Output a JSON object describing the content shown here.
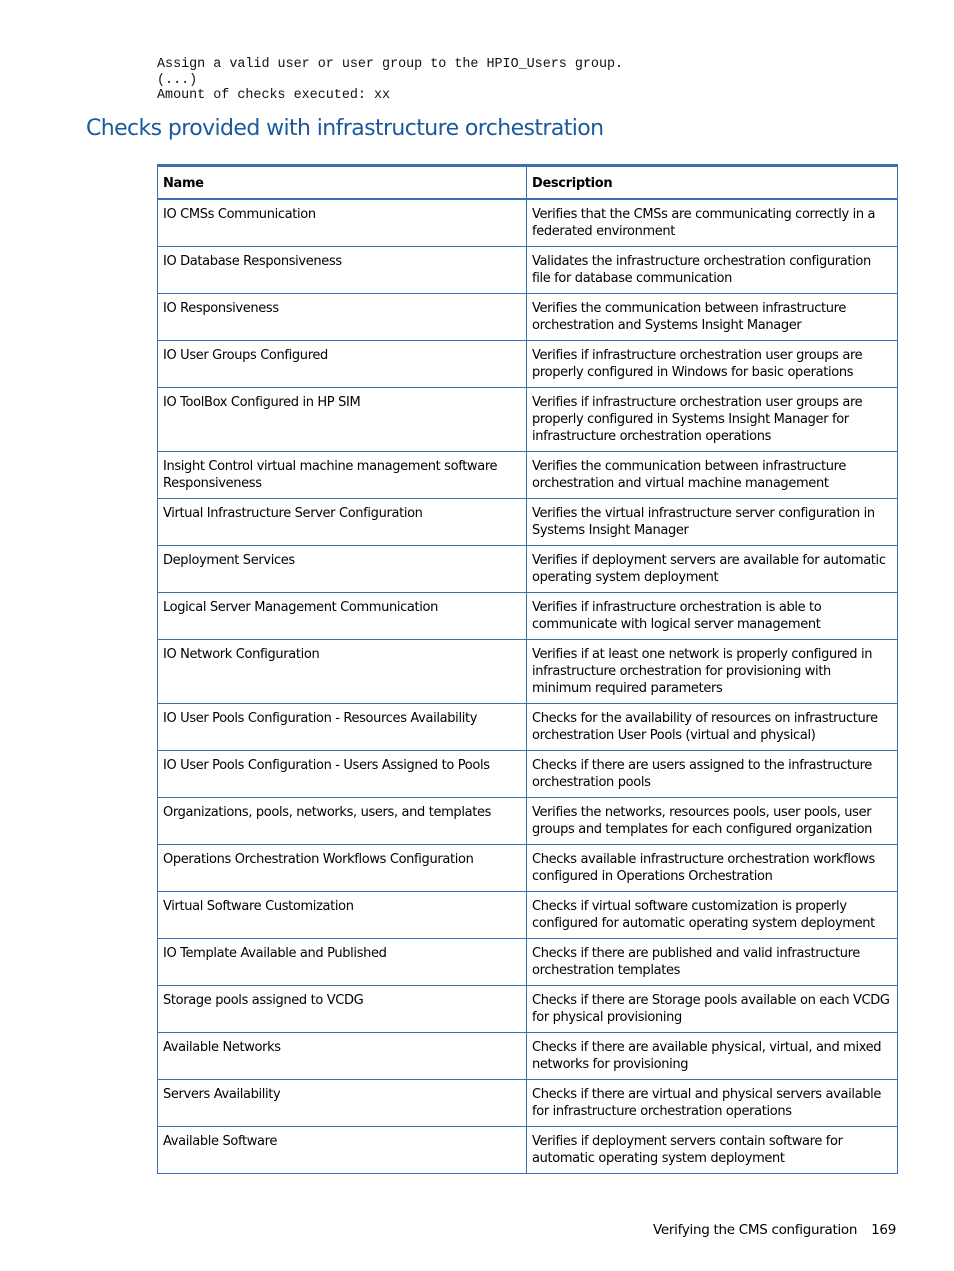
{
  "code_block": {
    "lines": [
      "Assign a valid user or user group to the HPIO_Users group.",
      "(...)",
      "Amount of checks executed: xx"
    ]
  },
  "section_title": "Checks provided with infrastructure orchestration",
  "table": {
    "headers": [
      "Name",
      "Description"
    ],
    "rows": [
      {
        "name": "IO CMSs Communication",
        "description": "Verifies that the CMSs are communicating correctly in a federated environment"
      },
      {
        "name": "IO Database Responsiveness",
        "description": "Validates the infrastructure orchestration configuration file for database communication"
      },
      {
        "name": "IO Responsiveness",
        "description": "Verifies the communication between infrastructure orchestration and Systems Insight Manager"
      },
      {
        "name": "IO User Groups Configured",
        "description": "Verifies if infrastructure orchestration user groups are properly configured in Windows for basic operations"
      },
      {
        "name": "IO ToolBox Configured in HP SIM",
        "description": "Verifies if infrastructure orchestration user groups are properly configured in Systems Insight Manager for infrastructure orchestration operations"
      },
      {
        "name": "Insight Control virtual machine management software Responsiveness",
        "description": "Verifies the communication between infrastructure orchestration and virtual machine management"
      },
      {
        "name": "Virtual Infrastructure Server Configuration",
        "description": "Verifies the virtual infrastructure server configuration in Systems Insight Manager"
      },
      {
        "name": "Deployment Services",
        "description": "Verifies if deployment servers are available for automatic operating system deployment"
      },
      {
        "name": "Logical Server Management Communication",
        "description": "Verifies if infrastructure orchestration is able to communicate with logical server management"
      },
      {
        "name": "IO Network Configuration",
        "description": "Verifies if at least one network is properly configured in infrastructure orchestration for provisioning with minimum required parameters"
      },
      {
        "name": "IO User Pools Configuration - Resources Availability",
        "description": "Checks for the availability of resources on infrastructure orchestration User Pools (virtual and physical)"
      },
      {
        "name": "IO User Pools Configuration - Users Assigned to Pools",
        "description": "Checks if there are users assigned to the infrastructure orchestration pools"
      },
      {
        "name": "Organizations, pools, networks, users, and templates",
        "description": "Verifies the networks, resources pools, user pools, user groups and templates for each configured organization"
      },
      {
        "name": "Operations Orchestration Workflows Configuration",
        "description": "Checks available infrastructure orchestration workflows configured in Operations Orchestration"
      },
      {
        "name": "Virtual Software Customization",
        "description": "Checks if virtual software customization is properly configured for automatic operating system deployment"
      },
      {
        "name": "IO Template Available and Published",
        "description": "Checks if there are published and valid infrastructure orchestration templates"
      },
      {
        "name": "Storage pools assigned to VCDG",
        "description": "Checks if there are Storage pools available on each VCDG for physical provisioning"
      },
      {
        "name": "Available Networks",
        "description": "Checks if there are available physical, virtual, and mixed networks for provisioning"
      },
      {
        "name": "Servers Availability",
        "description": "Checks if there are virtual and physical servers available for infrastructure orchestration operations"
      },
      {
        "name": "Available Software",
        "description": "Verifies if deployment servers contain software for automatic operating system deployment"
      }
    ]
  },
  "footer": {
    "section": "Verifying the CMS configuration",
    "page_number": "169"
  },
  "colors": {
    "title": "#1a5a9c",
    "table_border": "#3a6fb0"
  }
}
